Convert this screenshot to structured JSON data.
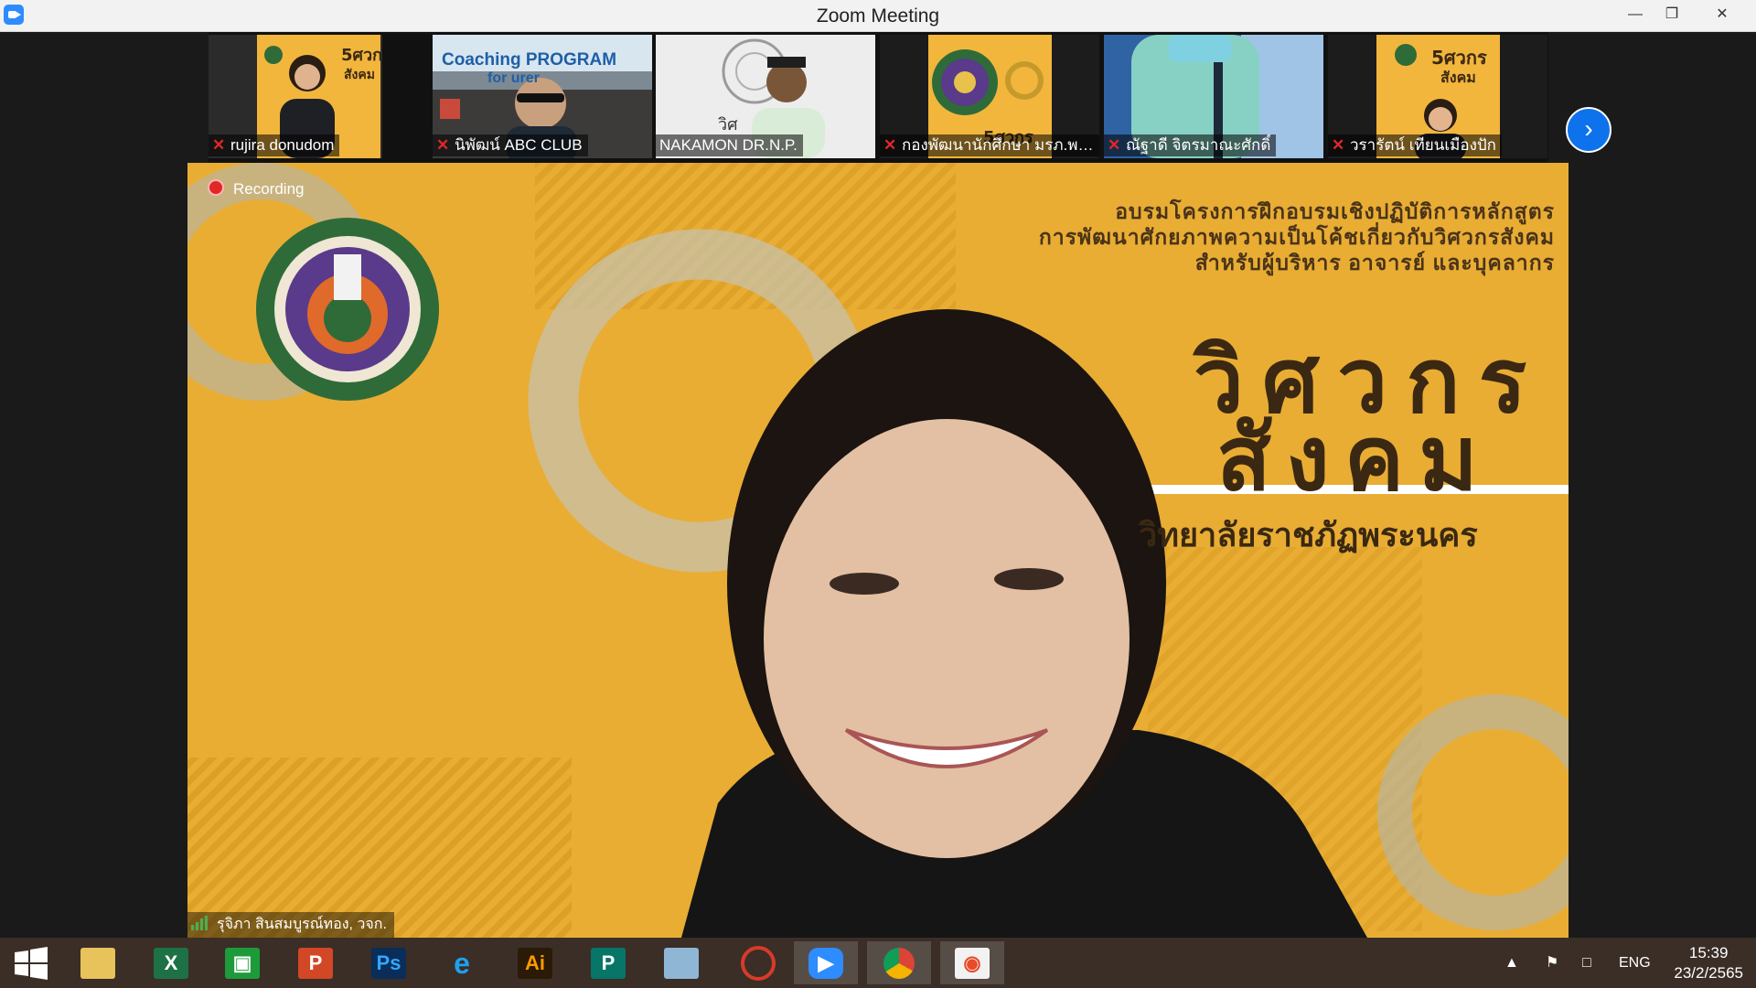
{
  "window": {
    "title": "Zoom Meeting"
  },
  "gallery": {
    "participants": [
      {
        "name": "rujira donudom",
        "muted": true
      },
      {
        "name": "นิพัฒน์ ABC CLUB",
        "muted": true
      },
      {
        "name": "NAKAMON DR.N.P.",
        "muted": false
      },
      {
        "name": "กองพัฒนานักศึกษา มรภ.พร...",
        "muted": true
      },
      {
        "name": "ณัฐาดี จิตรมาณะศักดิ์",
        "muted": true
      },
      {
        "name": "วรารัตน์ เทียนเมืองปัก",
        "muted": true
      }
    ],
    "tile_text": {
      "coaching": "Coaching PROGRAM",
      "coaching_sub": "for    urer",
      "poster_small": "วิศวกร สังคม"
    }
  },
  "main": {
    "recording_label": "Recording",
    "speaker_name": "รุจิภา สินสมบูรณ์ทอง, วจก.",
    "banner": {
      "line1": "อบรมโครงการฝึกอบรมเชิงปฏิบัติการหลักสูตร",
      "line2": "การพัฒนาศักยภาพความเป็นโค้ชเกี่ยวกับวิศวกรสังคม",
      "line3": "สำหรับผู้บริหาร อาจารย์ และบุคลากร",
      "big1": "วิศวกร",
      "big2": "สังคม",
      "university": "วิทยาลัยราชภัฏพระนคร"
    }
  },
  "taskbar": {
    "apps": [
      "windows-start",
      "file-explorer",
      "excel",
      "store",
      "powerpoint",
      "photoshop",
      "internet-explorer",
      "illustrator",
      "publisher",
      "notes",
      "photoscape",
      "zoom",
      "chrome",
      "camera"
    ],
    "lang": "ENG",
    "time": "15:39",
    "date": "23/2/2565"
  }
}
